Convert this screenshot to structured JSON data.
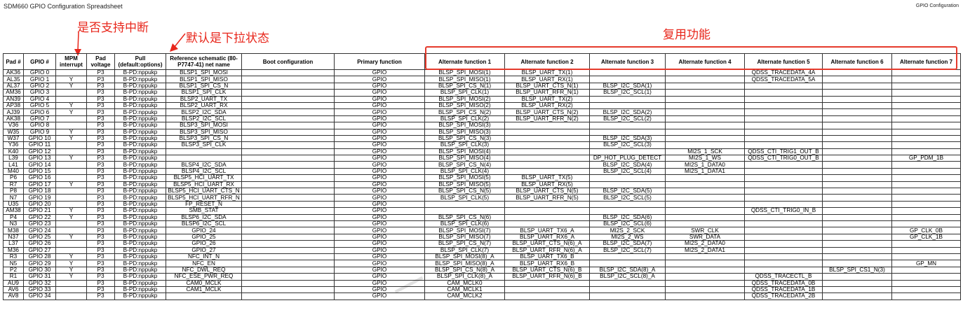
{
  "doc": {
    "title": "SDM660 GPIO Configuration Spreadsheet",
    "tag": "GPIO Configuration"
  },
  "annotations": {
    "mpm_note": "是否支持中断",
    "pull_note": "默认是下拉状态",
    "alt_note": "复用功能",
    "accent_color": "#e53a2c"
  },
  "table": {
    "headers": [
      "Pad #",
      "GPIO #",
      "MPM interrupt",
      "Pad voltage",
      "Pull (default:options)",
      "Reference schematic (80-P7747-41) net name",
      "Boot configuration",
      "Primary function",
      "Alternate function 1",
      "Alternate function 2",
      "Alternate function 3",
      "Alternate function 4",
      "Alternate function 5",
      "Alternate function 6",
      "Alternate function 7"
    ],
    "rows": [
      [
        "AK36",
        "GPIO 0",
        "",
        "P3",
        "B-PD:nppukp",
        "BLSP1_SPI_MOSI",
        "",
        "GPIO",
        "BLSP_SPI_MOSI(1)",
        "BLSP_UART_TX(1)",
        "",
        "",
        "QDSS_TRACEDATA_4A",
        "",
        ""
      ],
      [
        "AL35",
        "GPIO 1",
        "Y",
        "P3",
        "B-PD:nppukp",
        "BLSP1_SPI_MISO",
        "",
        "GPIO",
        "BLSP_SPI_MISO(1)",
        "BLSP_UART_RX(1)",
        "",
        "",
        "QDSS_TRACEDATA_5A",
        "",
        ""
      ],
      [
        "AL37",
        "GPIO 2",
        "Y",
        "P3",
        "B-PD:nppukp",
        "BLSP1_SPI_CS_N",
        "",
        "GPIO",
        "BLSP_SPI_CS_N(1)",
        "BLSP_UART_CTS_N(1)",
        "BLSP_I2C_SDA(1)",
        "",
        "",
        "",
        ""
      ],
      [
        "AM36",
        "GPIO 3",
        "",
        "P3",
        "B-PD:nppukp",
        "BLSP1_SPI_CLK",
        "",
        "GPIO",
        "BLSP_SPI_CLK(1)",
        "BLSP_UART_RFR_N(1)",
        "BLSP_I2C_SCL(1)",
        "",
        "",
        "",
        ""
      ],
      [
        "AN39",
        "GPIO 4",
        "",
        "P3",
        "B-PD:nppukp",
        "BLSP2_UART_TX",
        "",
        "GPIO",
        "BLSP_SPI_MOSI(2)",
        "BLSP_UART_TX(2)",
        "",
        "",
        "",
        "",
        ""
      ],
      [
        "AP38",
        "GPIO 5",
        "Y",
        "P3",
        "B-PD:nppukp",
        "BLSP2_UART_RX",
        "",
        "GPIO",
        "BLSP_SPI_MISO(2)",
        "BLSP_UART_RX(2)",
        "",
        "",
        "",
        "",
        ""
      ],
      [
        "AJ39",
        "GPIO 6",
        "Y",
        "P3",
        "B-PD:nppukp",
        "BLSP2_I2C_SDA",
        "",
        "GPIO",
        "BLSP_SPI_CS_N(2)",
        "BLSP_UART_CTS_N(2)",
        "BLSP_I2C_SDA(2)",
        "",
        "",
        "",
        ""
      ],
      [
        "AK38",
        "GPIO 7",
        "",
        "P3",
        "B-PD:nppukp",
        "BLSP2_I2C_SCL",
        "",
        "GPIO",
        "BLSP_SPI_CLK(2)",
        "BLSP_UART_RFR_N(2)",
        "BLSP_I2C_SCL(2)",
        "",
        "",
        "",
        ""
      ],
      [
        "V36",
        "GPIO 8",
        "",
        "P3",
        "B-PD:nppukp",
        "BLSP3_SPI_MOSI",
        "",
        "GPIO",
        "BLSP_SPI_MOSI(3)",
        "",
        "",
        "",
        "",
        "",
        ""
      ],
      [
        "W35",
        "GPIO 9",
        "Y",
        "P3",
        "B-PD:nppukp",
        "BLSP3_SPI_MISO",
        "",
        "GPIO",
        "BLSP_SPI_MISO(3)",
        "",
        "",
        "",
        "",
        "",
        ""
      ],
      [
        "W37",
        "GPIO 10",
        "Y",
        "P3",
        "B-PD:nppukp",
        "BLSP3_SPI_CS_N",
        "",
        "GPIO",
        "BLSP_SPI_CS_N(3)",
        "",
        "BLSP_I2C_SDA(3)",
        "",
        "",
        "",
        ""
      ],
      [
        "Y36",
        "GPIO 11",
        "",
        "P3",
        "B-PD:nppukp",
        "BLSP3_SPI_CLK",
        "",
        "GPIO",
        "BLSP_SPI_CLK(3)",
        "",
        "BLSP_I2C_SCL(3)",
        "",
        "",
        "",
        ""
      ],
      [
        "K40",
        "GPIO 12",
        "",
        "P3",
        "B-PD:nppukp",
        "",
        "",
        "GPIO",
        "BLSP_SPI_MOSI(4)",
        "",
        "",
        "MI2S_1_SCK",
        "QDSS_CTI_TRIG1_OUT_B",
        "",
        ""
      ],
      [
        "L39",
        "GPIO 13",
        "Y",
        "P3",
        "B-PD:nppukp",
        "",
        "",
        "GPIO",
        "BLSP_SPI_MISO(4)",
        "",
        "DP_HOT_PLUG_DETECT",
        "MI2S_1_WS",
        "QDSS_CTI_TRIG0_OUT_B",
        "",
        "GP_PDM_1B"
      ],
      [
        "L41",
        "GPIO 14",
        "",
        "P3",
        "B-PD:nppukp",
        "BLSP4_I2C_SDA",
        "",
        "GPIO",
        "BLSP_SPI_CS_N(4)",
        "",
        "BLSP_I2C_SDA(4)",
        "MI2S_1_DATA0",
        "",
        "",
        ""
      ],
      [
        "M40",
        "GPIO 15",
        "",
        "P3",
        "B-PD:nppukp",
        "BLSP4_I2C_SCL",
        "",
        "GPIO",
        "BLSP_SPI_CLK(4)",
        "",
        "BLSP_I2C_SCL(4)",
        "MI2S_1_DATA1",
        "",
        "",
        ""
      ],
      [
        "P6",
        "GPIO 16",
        "",
        "P3",
        "B-PD:nppukp",
        "BLSP5_HCI_UART_TX",
        "",
        "GPIO",
        "BLSP_SPI_MOSI(5)",
        "BLSP_UART_TX(5)",
        "",
        "",
        "",
        "",
        ""
      ],
      [
        "R7",
        "GPIO 17",
        "Y",
        "P3",
        "B-PD:nppukp",
        "BLSP5_HCI_UART_RX",
        "",
        "GPIO",
        "BLSP_SPI_MISO(5)",
        "BLSP_UART_RX(5)",
        "",
        "",
        "",
        "",
        ""
      ],
      [
        "P8",
        "GPIO 18",
        "",
        "P3",
        "B-PD:nppukp",
        "BLSP5_HCI_UART_CTS_N",
        "",
        "GPIO",
        "BLSP_SPI_CS_N(5)",
        "BLSP_UART_CTS_N(5)",
        "BLSP_I2C_SDA(5)",
        "",
        "",
        "",
        ""
      ],
      [
        "N7",
        "GPIO 19",
        "",
        "P3",
        "B-PD:nppukp",
        "BLSP5_HCI_UART_RFR_N",
        "",
        "GPIO",
        "BLSP_SPI_CLK(5)",
        "BLSP_UART_RFR_N(5)",
        "BLSP_I2C_SCL(5)",
        "",
        "",
        "",
        ""
      ],
      [
        "U35",
        "GPIO 20",
        "",
        "P3",
        "B-PD:nppukp",
        "FP_RESET_N",
        "",
        "GPIO",
        "",
        "",
        "",
        "",
        "",
        "",
        ""
      ],
      [
        "AM38",
        "GPIO 21",
        "Y",
        "P3",
        "B-PD:nppukp",
        "SMB_STAT",
        "",
        "GPIO",
        "",
        "",
        "",
        "",
        "QDSS_CTI_TRIG0_IN_B",
        "",
        ""
      ],
      [
        "P4",
        "GPIO 22",
        "Y",
        "P3",
        "B-PD:nppukp",
        "BLSP6_I2C_SDA",
        "",
        "GPIO",
        "BLSP_SPI_CS_N(6)",
        "",
        "BLSP_I2C_SDA(6)",
        "",
        "",
        "",
        ""
      ],
      [
        "N3",
        "GPIO 23",
        "",
        "P3",
        "B-PD:nppukp",
        "BLSP6_I2C_SCL",
        "",
        "GPIO",
        "BLSP_SPI_CLK(6)",
        "",
        "BLSP_I2C_SCL(6)",
        "",
        "",
        "",
        ""
      ],
      [
        "M38",
        "GPIO 24",
        "",
        "P3",
        "B-PD:nppukp",
        "GPIO_24",
        "",
        "GPIO",
        "BLSP_SPI_MOSI(7)",
        "BLSP_UART_TX6_A",
        "MI2S_2_SCK",
        "SWR_CLK",
        "",
        "",
        "GP_CLK_0B"
      ],
      [
        "N37",
        "GPIO 25",
        "Y",
        "P3",
        "B-PD:nppukp",
        "GPIO_25",
        "",
        "GPIO",
        "BLSP_SPI_MISO(7)",
        "BLSP_UART_RX6_A",
        "MI2S_2_WS",
        "SWR_DATA",
        "",
        "",
        "GP_CLK_1B"
      ],
      [
        "L37",
        "GPIO 26",
        "",
        "P3",
        "B-PD:nppukp",
        "GPIO_26",
        "",
        "GPIO",
        "BLSP_SPI_CS_N(7)",
        "BLSP_UART_CTS_N(6)_A",
        "BLSP_I2C_SDA(7)",
        "MI2S_2_DATA0",
        "",
        "",
        ""
      ],
      [
        "M36",
        "GPIO 27",
        "",
        "P3",
        "B-PD:nppukp",
        "GPIO_27",
        "",
        "GPIO",
        "BLSP_SPI_CLK(7)",
        "BLSP_UART_RFR_N(6)_A",
        "BLSP_I2C_SCL(7)",
        "MI2S_2_DATA1",
        "",
        "",
        ""
      ],
      [
        "R3",
        "GPIO 28",
        "Y",
        "P3",
        "B-PD:nppukp",
        "NFC_INT_N",
        "",
        "GPIO",
        "BLSP_SPI_MOSI(8)_A",
        "BLSP_UART_TX6_B",
        "",
        "",
        "",
        "",
        ""
      ],
      [
        "N5",
        "GPIO 29",
        "Y",
        "P3",
        "B-PD:nppukp",
        "NFC_EN",
        "",
        "GPIO",
        "BLSP_SPI_MISO(8)_A",
        "BLSP_UART_RX6_B",
        "",
        "",
        "",
        "",
        "GP_MN"
      ],
      [
        "P2",
        "GPIO 30",
        "Y",
        "P3",
        "B-PD:nppukp",
        "NFC_DWL_REQ",
        "",
        "GPIO",
        "BLSP_SPI_CS_N(8)_A",
        "BLSP_UART_CTS_N(6)_B",
        "BLSP_I2C_SDA(8)_A",
        "",
        "",
        "BLSP_SPI_CS1_N(3)",
        ""
      ],
      [
        "R1",
        "GPIO 31",
        "Y",
        "P3",
        "B-PD:nppukp",
        "NFC_ESE_PWR_REQ",
        "",
        "GPIO",
        "BLSP_SPI_CLK(8)_A",
        "BLSP_UART_RFR_N(6)_B",
        "BLSP_I2C_SCL(8)_A",
        "",
        "QDSS_TRACECTL_B",
        "",
        ""
      ],
      [
        "AU9",
        "GPIO 32",
        "",
        "P3",
        "B-PD:nppukp",
        "CAM0_MCLK",
        "",
        "GPIO",
        "CAM_MCLK0",
        "",
        "",
        "",
        "QDSS_TRACEDATA_0B",
        "",
        ""
      ],
      [
        "AV6",
        "GPIO 33",
        "",
        "P3",
        "B-PD:nppukp",
        "CAM1_MCLK",
        "",
        "GPIO",
        "CAM_MCLK1",
        "",
        "",
        "",
        "QDSS_TRACEDATA_1B",
        "",
        ""
      ],
      [
        "AV8",
        "GPIO 34",
        "",
        "P3",
        "B-PD:nppukp",
        "",
        "",
        "GPIO",
        "CAM_MCLK2",
        "",
        "",
        "",
        "QDSS_TRACEDATA_2B",
        "",
        ""
      ]
    ]
  }
}
